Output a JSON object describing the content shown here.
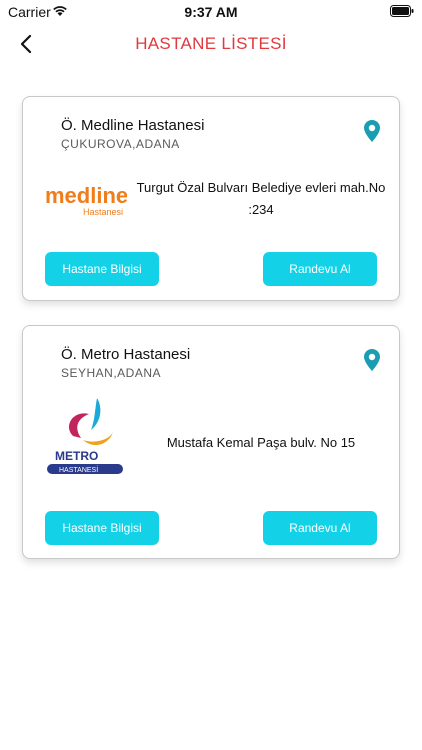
{
  "status_bar": {
    "carrier": "Carrier",
    "time": "9:37 AM"
  },
  "header": {
    "title": "HASTANE LİSTESİ"
  },
  "colors": {
    "accent": "#13d2e8",
    "title": "#e0393e",
    "pin": "#1a9db0"
  },
  "hospitals": [
    {
      "name": "Ö. Medline Hastanesi",
      "district": "ÇUKUROVA,ADANA",
      "address": "Turgut Özal Bulvarı Belediye evleri mah.No :234",
      "logo": {
        "text": "medline",
        "subtext": "Hastanesi"
      },
      "info_button": "Hastane Bilgisi",
      "appointment_button": "Randevu Al"
    },
    {
      "name": "Ö. Metro Hastanesi",
      "district": "SEYHAN,ADANA",
      "address": "Mustafa Kemal Paşa bulv. No 15",
      "logo": {
        "text": "METRO",
        "subtext": "HASTANESİ"
      },
      "info_button": "Hastane Bilgisi",
      "appointment_button": "Randevu Al"
    }
  ]
}
